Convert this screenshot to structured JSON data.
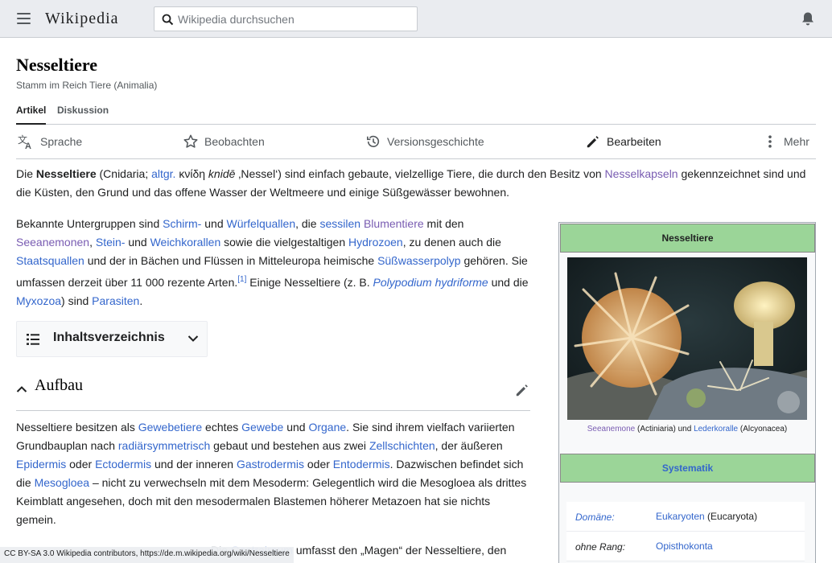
{
  "header": {
    "wordmark": "Wikipedia",
    "search_placeholder": "Wikipedia durchsuchen"
  },
  "article": {
    "title": "Nesseltiere",
    "subtitle": "Stamm im Reich Tiere (Animalia)",
    "tabs": [
      "Artikel",
      "Diskussion"
    ],
    "actions": [
      "Sprache",
      "Beobachten",
      "Versionsgeschichte",
      "Bearbeiten",
      "Mehr"
    ]
  },
  "intro": {
    "die": "Die ",
    "bold": "Nesseltiere",
    "t1": " (Cnidaria; ",
    "altgr": "altgr.",
    "greek": " κνίδη ",
    "knide": "knidē",
    "t2": " ‚Nessel‘) sind einfach gebaute, vielzellige Tiere, die durch den Besitz von ",
    "nesselkapseln": "Nesselkapseln",
    "t3": " gekennzeichnet sind und die Küsten, den Grund und das offene Wasser der Weltmeere und einige Süßgewässer bewohnen."
  },
  "para2": {
    "a": "Bekannte Untergruppen sind ",
    "schirm": "Schirm-",
    "b": " und ",
    "wuerfel": "Würfelquallen",
    "c": ", die ",
    "sessilen": "sessilen",
    "blumen": "Blumentiere",
    "d": " mit den",
    "seeanemonen": "Seeanemonen",
    "e": ", ",
    "stein": "Stein-",
    "f": " und ",
    "weich": "Weichkorallen",
    "g": " sowie die vielgestaltigen ",
    "hydrozoen": "Hydrozoen",
    "h": ", zu denen auch die",
    "staats": "Staatsquallen",
    "i": " und der in Bächen und Flüssen in Mitteleuropa heimische ",
    "suess": "Süßwasserpolyp",
    "j": " gehören. Sie",
    "k": "umfassen derzeit über 11 000 rezente Arten.",
    "ref": "[1]",
    "l": " Einige Nesseltiere (z. B. ",
    "polypodium": "Polypodium hydriforme",
    "m": " und die",
    "myxozoa": "Myxozoa",
    "n": ") sind ",
    "parasiten": "Parasiten",
    "o": "."
  },
  "toc": {
    "label": "Inhaltsverzeichnis"
  },
  "section": {
    "heading": "Aufbau",
    "s1": "Nesseltiere besitzen als ",
    "gewebetiere": "Gewebetiere",
    "s2": " echtes ",
    "gewebe": "Gewebe",
    "s3": " und ",
    "organe": "Organe",
    "s4": ". Sie sind ihrem vielfach variierten",
    "s5": "Grundbauplan nach ",
    "radiaer": "radiärsymmetrisch",
    "s6": " gebaut und bestehen aus zwei ",
    "zellschichten": "Zellschichten",
    "s7": ", der äußeren",
    "epidermis": "Epidermis",
    "s8": " oder ",
    "ectodermis": "Ectodermis",
    "s9": " und der inneren ",
    "gastrodermis": "Gastrodermis",
    "s10": " oder ",
    "entodermis": "Entodermis",
    "s11": ". Dazwischen befindet sich",
    "s12": "die ",
    "mesogloea": "Mesogloea",
    "s13": " – nicht zu verwechseln mit dem Mesoderm: Gelegentlich wird die Mesogloea als drittes",
    "s14": "Keimblatt angesehen, doch mit den mesodermalen Blastemen höherer Metazoen hat sie nichts",
    "s15": "gemein.",
    "s16a": "Die ",
    "s16b": "Gastralraum",
    "s16c": " umfasst den „Magen“ der Nesseltiere, den"
  },
  "infobox": {
    "title": "Nesseltiere",
    "caption_a": "Seeanemone",
    "caption_b": " (Actiniaria) und ",
    "caption_c": "Lederkoralle",
    "caption_d": " (Alcyonacea)",
    "systematik": "Systematik",
    "rows": [
      {
        "key": "Domäne:",
        "value": "Eukaryoten",
        "extra": " (Eucaryota)"
      },
      {
        "key": "ohne Rang:",
        "value": "Opisthokonta",
        "extra": ""
      }
    ]
  },
  "footer": {
    "text": "CC BY-SA 3.0 Wikipedia contributors, https://de.m.wikipedia.org/wiki/Nesseltiere"
  },
  "colors": {
    "link": "#3366cc",
    "visited": "#795cb2",
    "infobox_header": "#9bd598"
  }
}
